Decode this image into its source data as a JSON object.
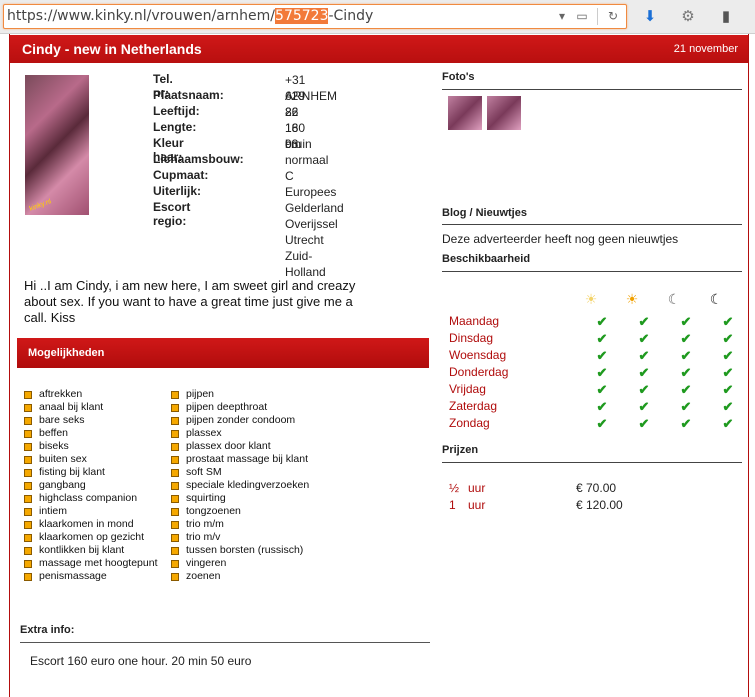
{
  "browser": {
    "url_prefix": "https://www.kinky.nl/vrouwen/arnhem/",
    "url_highlight": "575723",
    "url_suffix": "-Cindy"
  },
  "header": {
    "title": "Cindy - new in Netherlands",
    "date": "21 november"
  },
  "profile": {
    "fields": [
      {
        "label": "Tel. nr:",
        "values": [
          "+31 629 82 18 93"
        ]
      },
      {
        "label": "Plaatsnaam:",
        "values": [
          "ARNHEM"
        ]
      },
      {
        "label": "Leeftijd:",
        "values": [
          "26"
        ]
      },
      {
        "label": "Lengte:",
        "values": [
          "160 cm"
        ]
      },
      {
        "label": "Kleur haar:",
        "values": [
          "bruin"
        ]
      },
      {
        "label": "Lichaamsbouw:",
        "values": [
          "normaal"
        ]
      },
      {
        "label": "Cupmaat:",
        "values": [
          "C"
        ]
      },
      {
        "label": "Uiterlijk:",
        "values": [
          "Europees"
        ]
      },
      {
        "label": "Escort regio:",
        "values": [
          "Gelderland",
          "Overijssel",
          "Utrecht",
          "Zuid-Holland"
        ]
      }
    ],
    "description": "Hi ..I am Cindy, i am new here, I am sweet girl and creazy about sex. If you want to have a great time just give me a call. Kiss"
  },
  "options": {
    "title": "Mogelijkheden",
    "col1": [
      "aftrekken",
      "anaal bij klant",
      "bare seks",
      "beffen",
      "biseks",
      "buiten sex",
      "fisting bij klant",
      "gangbang",
      "highclass companion",
      "intiem",
      "klaarkomen in mond",
      "klaarkomen op gezicht",
      "kontlikken bij klant",
      "massage met hoogtepunt",
      "penismassage"
    ],
    "col2": [
      "pijpen",
      "pijpen deepthroat",
      "pijpen zonder condoom",
      "plassex",
      "plassex door klant",
      "prostaat massage bij klant",
      "soft SM",
      "speciale kledingverzoeken",
      "squirting",
      "tongzoenen",
      "trio m/m",
      "trio m/v",
      "tussen borsten (russisch)",
      "vingeren",
      "zoenen"
    ]
  },
  "extra": {
    "title": "Extra info:",
    "text": "Escort 160 euro one hour. 20 min 50 euro"
  },
  "photos": {
    "title": "Foto's"
  },
  "blog": {
    "title": "Blog / Nieuwtjes",
    "text": "Deze adverteerder heeft nog geen nieuwtjes"
  },
  "availability": {
    "title": "Beschikbaarheid",
    "icons": [
      "sun-pale-icon",
      "sun-icon",
      "moon-grey-icon",
      "moon-dark-icon"
    ],
    "days": [
      "Maandag",
      "Dinsdag",
      "Woensdag",
      "Donderdag",
      "Vrijdag",
      "Zaterdag",
      "Zondag"
    ]
  },
  "prices": {
    "title": "Prijzen",
    "rows": [
      {
        "amount": "½",
        "unit": "uur",
        "price": "€ 70.00"
      },
      {
        "amount": "1",
        "unit": "uur",
        "price": "€ 120.00"
      }
    ]
  },
  "colors": {
    "brand_red": "#c41212",
    "check_green": "#1f9a1f",
    "bullet_orange": "#f5a800"
  }
}
